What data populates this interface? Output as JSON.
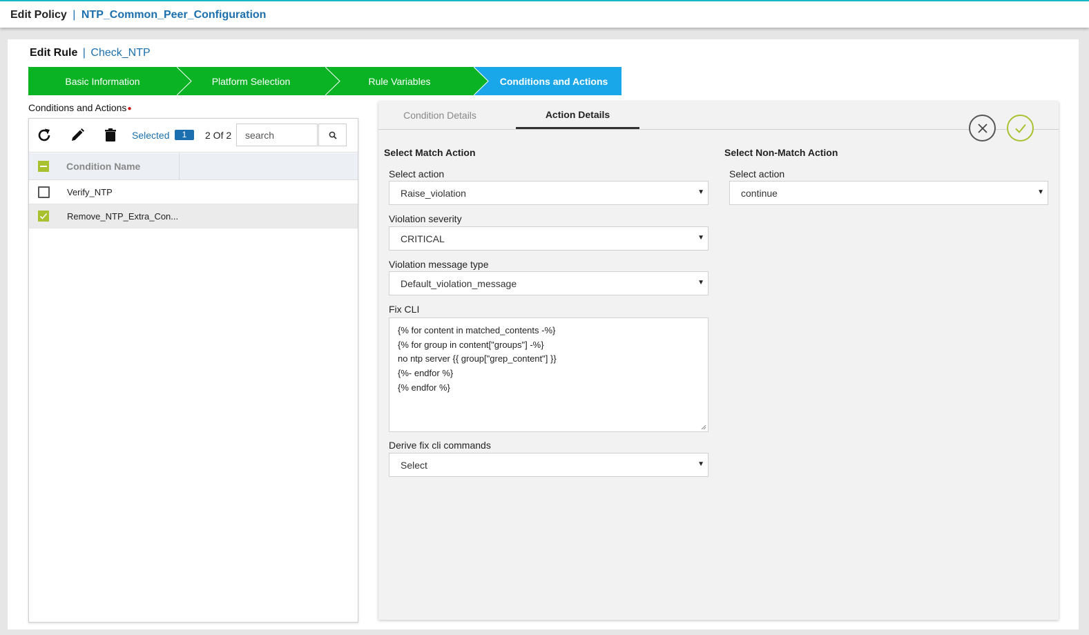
{
  "header": {
    "prefix": "Edit Policy",
    "separator": "|",
    "policy_name": "NTP_Common_Peer_Configuration"
  },
  "rule": {
    "prefix": "Edit Rule",
    "separator": "|",
    "rule_name": "Check_NTP"
  },
  "wizard": {
    "steps": [
      {
        "label": "Basic Information",
        "state": "complete"
      },
      {
        "label": "Platform Selection",
        "state": "complete"
      },
      {
        "label": "Rule Variables",
        "state": "complete"
      },
      {
        "label": "Conditions and Actions",
        "state": "active"
      }
    ]
  },
  "conditions": {
    "label": "Conditions and Actions",
    "required_marker": "●",
    "toolbar": {
      "refresh_icon": "refresh-icon",
      "edit_icon": "pencil-icon",
      "delete_icon": "trash-icon",
      "selected_label": "Selected",
      "selected_count": "1",
      "count_text": "2 Of 2",
      "search_placeholder": "search",
      "search_icon": "search-icon"
    },
    "table": {
      "header": "Condition Name",
      "rows": [
        {
          "name": "Verify_NTP",
          "checked": false
        },
        {
          "name": "Remove_NTP_Extra_Con...",
          "checked": true
        }
      ]
    }
  },
  "details": {
    "tabs": [
      {
        "label": "Condition Details",
        "active": false
      },
      {
        "label": "Action Details",
        "active": true
      }
    ],
    "cancel_icon": "close-icon",
    "confirm_icon": "check-icon",
    "match": {
      "title": "Select Match Action",
      "select_action_label": "Select action",
      "select_action_value": "Raise_violation",
      "severity_label": "Violation severity",
      "severity_value": "CRITICAL",
      "message_type_label": "Violation message type",
      "message_type_value": "Default_violation_message",
      "fix_cli_label": "Fix CLI",
      "fix_cli_lines": [
        "{% for content in matched_contents -%}",
        "{% for group in content[\"groups\"] -%}",
        "no ntp server {{ group[\"grep_content\"] }}",
        "{%- endfor %}",
        "{% endfor %}"
      ],
      "derive_label": "Derive fix cli commands",
      "derive_value": "Select"
    },
    "nonmatch": {
      "title": "Select Non-Match Action",
      "select_action_label": "Select action",
      "select_action_value": "continue"
    }
  },
  "colors": {
    "step_complete": "#0ab324",
    "step_active": "#1aa7ea",
    "link_blue": "#1b6fae",
    "check_green": "#a9c12f"
  }
}
